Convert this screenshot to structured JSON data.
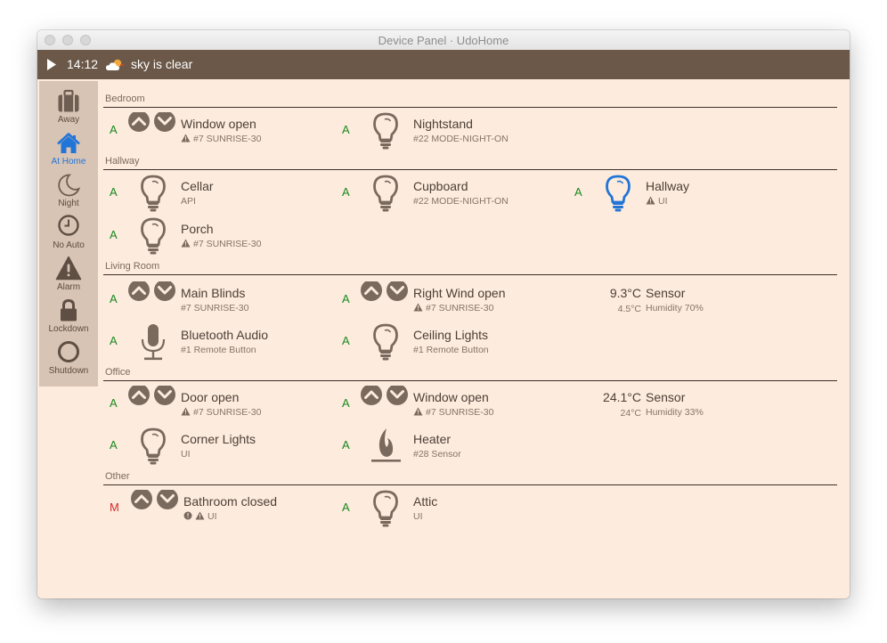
{
  "window": {
    "title": "Device Panel · UdoHome"
  },
  "topbar": {
    "time": "14:12",
    "weather": "sky is clear"
  },
  "sidebar": {
    "items": [
      {
        "label": "Away",
        "icon": "suitcase-icon"
      },
      {
        "label": "At Home",
        "icon": "house-icon"
      },
      {
        "label": "Night",
        "icon": "moon-icon"
      },
      {
        "label": "No Auto",
        "icon": "clock-icon"
      },
      {
        "label": "Alarm",
        "icon": "warning-icon"
      },
      {
        "label": "Lockdown",
        "icon": "lock-icon"
      },
      {
        "label": "Shutdown",
        "icon": "power-icon"
      }
    ]
  },
  "colors": {
    "accent": "#2275d7",
    "auto": "#16891f",
    "manual": "#d42a2a",
    "icon": "#7a6a5e",
    "topbar": "#6b5848"
  },
  "rooms": {
    "bedroom": {
      "title": "Bedroom",
      "devices": [
        {
          "mode": "A",
          "name": "Window open",
          "sub": "#7 SUNRISE-30",
          "warn": true,
          "type": "shutter"
        },
        {
          "mode": "A",
          "name": "Nightstand",
          "sub": "#22 MODE-NIGHT-ON",
          "type": "bulb"
        }
      ]
    },
    "hallway": {
      "title": "Hallway",
      "devices": [
        {
          "mode": "A",
          "name": "Cellar",
          "sub": "API",
          "type": "bulb"
        },
        {
          "mode": "A",
          "name": "Cupboard",
          "sub": "#22 MODE-NIGHT-ON",
          "type": "bulb"
        },
        {
          "mode": "A",
          "name": "Hallway",
          "sub": "UI",
          "warn": true,
          "type": "bulb-on"
        },
        {
          "mode": "A",
          "name": "Porch",
          "sub": "#7 SUNRISE-30",
          "warn": true,
          "type": "bulb"
        }
      ]
    },
    "living": {
      "title": "Living Room",
      "devices": [
        {
          "mode": "A",
          "name": "Main Blinds",
          "sub": "#7 SUNRISE-30",
          "type": "shutter"
        },
        {
          "mode": "A",
          "name": "Right Wind open",
          "sub": "#7 SUNRISE-30",
          "warn": true,
          "type": "shutter"
        },
        {
          "name": "Sensor",
          "sub": "Humidity 70%",
          "temp": "9.3°C",
          "temp2": "4.5°C",
          "type": "sensor"
        },
        {
          "mode": "A",
          "name": "Bluetooth Audio",
          "sub": "#1 Remote Button",
          "type": "mic"
        },
        {
          "mode": "A",
          "name": "Ceiling Lights",
          "sub": "#1 Remote Button",
          "type": "bulb"
        }
      ]
    },
    "office": {
      "title": "Office",
      "devices": [
        {
          "mode": "A",
          "name": "Door open",
          "sub": "#7 SUNRISE-30",
          "warn": true,
          "type": "shutter"
        },
        {
          "mode": "A",
          "name": "Window open",
          "sub": "#7 SUNRISE-30",
          "warn": true,
          "type": "shutter"
        },
        {
          "name": "Sensor",
          "sub": "Humidity 33%",
          "temp": "24.1°C",
          "temp2": "24°C",
          "type": "sensor"
        },
        {
          "mode": "A",
          "name": "Corner Lights",
          "sub": "UI",
          "type": "bulb"
        },
        {
          "mode": "A",
          "name": "Heater",
          "sub": "#28 Sensor",
          "type": "flame"
        }
      ]
    },
    "other": {
      "title": "Other",
      "devices": [
        {
          "mode": "M",
          "name": "Bathroom closed",
          "sub": "UI",
          "warn": true,
          "info": true,
          "type": "shutter"
        },
        {
          "mode": "A",
          "name": "Attic",
          "sub": "UI",
          "type": "bulb"
        }
      ]
    }
  }
}
